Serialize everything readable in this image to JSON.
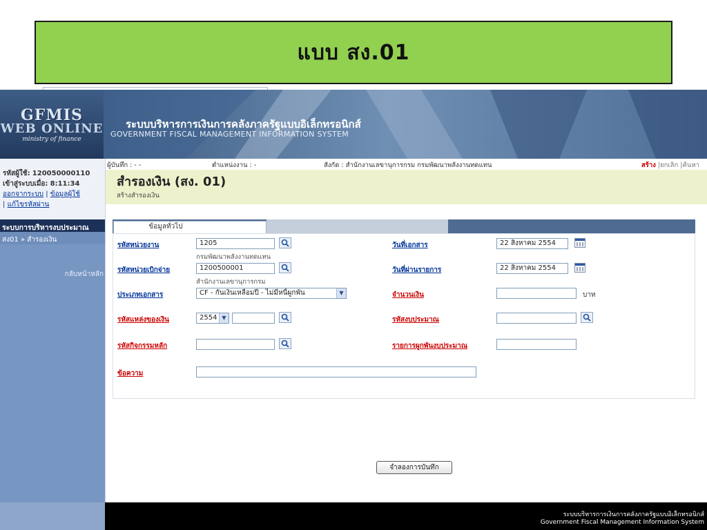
{
  "slide": {
    "banner": "แบบ สง.01"
  },
  "header": {
    "logo": {
      "line1": "GFMIS",
      "line2": "WEB ONLINE",
      "line3": "ministry of finance"
    },
    "title_th": "ระบบบริหารการเงินการคลังภาครัฐแบบอิเล็กทรอนิกส์",
    "title_en": "GOVERNMENT FISCAL MANAGEMENT INFORMATION SYSTEM"
  },
  "sidebar": {
    "user_id_label": "รหัสผู้ใช้:",
    "user_id": "120050000110",
    "login_label": "เข้าสู่ระบบเมื่อ:",
    "login_time": "8:11:34",
    "links": [
      "ออกจากระบบ",
      "ข้อมูลผู้ใช้",
      "แก้ไขรหัสผ่าน"
    ],
    "section": "ระบบการบริหารงบประมาณ",
    "item": "สง01 » สำรองเงิน",
    "back": "กลับหน้าหลัก"
  },
  "infobar": {
    "recorder": "ผู้บันทึก : - -",
    "position": "ตำแหน่งงาน : -",
    "affiliation": "สังกัด : สำนักงานเลขานุการกรม กรมพัฒนาพลังงานทดแทน",
    "actions": {
      "create": "สร้าง",
      "cancel": "|ยกเลิก",
      "search": "|ค้นหา"
    }
  },
  "page": {
    "title": "สำรองเงิน (สง. 01)",
    "subtitle": "สร้างสำรองเงิน"
  },
  "tabs": [
    "ข้อมูลทั่วไป"
  ],
  "form": {
    "agency_code": {
      "label": "รหัสหน่วยงาน",
      "value": "1205",
      "note": "กรมพัฒนาพลังงานทดแทน"
    },
    "doc_date": {
      "label": "วันที่เอกสาร",
      "value": "22 สิงหาคม 2554"
    },
    "disb_unit": {
      "label": "รหัสหน่วยเบิกจ่าย",
      "value": "1200500001",
      "note": "สำนักงานเลขานุการกรม"
    },
    "post_date": {
      "label": "วันที่ผ่านรายการ",
      "value": "22 สิงหาคม 2554"
    },
    "doc_type": {
      "label": "ประเภทเอกสาร",
      "value": "CF - กันเงินเหลื่อมปี - ไม่มีหนี้ผูกพัน"
    },
    "amount": {
      "label": "จำนวนเงิน",
      "value": "",
      "unit": "บาท"
    },
    "fund_source": {
      "label": "รหัสแหล่งของเงิน",
      "year": "2554",
      "value": ""
    },
    "budget_code": {
      "label": "รหัสงบประมาณ",
      "value": ""
    },
    "main_activity": {
      "label": "รหัสกิจกรรมหลัก",
      "value": ""
    },
    "commitment": {
      "label": "รายการผูกพันงบประมาณ",
      "value": ""
    },
    "message": {
      "label": "ข้อความ",
      "value": ""
    }
  },
  "buttons": {
    "simulate": "จำลองการบันทึก"
  },
  "footer": {
    "th": "ระบบบริหารการเงินการคลังภาครัฐแบบอิเล็กทรอนิกส์",
    "en": "Government Fiscal Management Information System"
  }
}
